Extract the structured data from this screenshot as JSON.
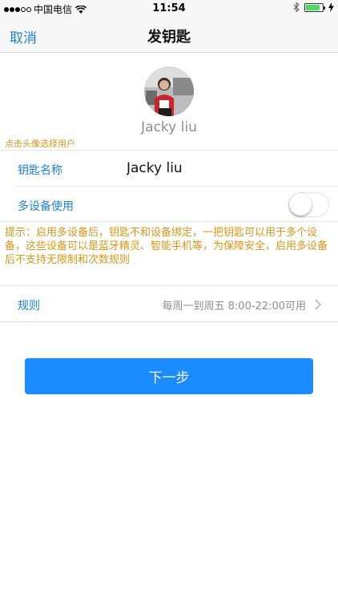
{
  "status_bar": {
    "carrier": "中国电信",
    "time": "11:54",
    "battery_level": 0.85,
    "icons": [
      "signal-icon",
      "wifi-icon",
      "bluetooth-icon",
      "battery-icon",
      "charging-icon"
    ]
  },
  "nav": {
    "cancel_label": "取消",
    "title": "发钥匙"
  },
  "user": {
    "name": "Jacky liu",
    "avatar_hint": "点击头像选择用户"
  },
  "form": {
    "key_name_label": "钥匙名称",
    "key_name_value": "Jacky liu",
    "multi_device_label": "多设备使用",
    "multi_device_enabled": false,
    "tip": "提示：启用多设备后，钥匙不和设备绑定，一把钥匙可以用于多个设备，这些设备可以是蓝牙精灵、智能手机等，为保障安全，启用多设备后不支持无限制和次数规则",
    "rule_label": "规则",
    "rule_value": "每周一到周五 8:00-22:00可用"
  },
  "actions": {
    "next_label": "下一步"
  },
  "colors": {
    "accent": "#1e7fd6",
    "button": "#1b8cff",
    "hint": "#d7961a",
    "secondary_text": "#8e8e8e"
  }
}
